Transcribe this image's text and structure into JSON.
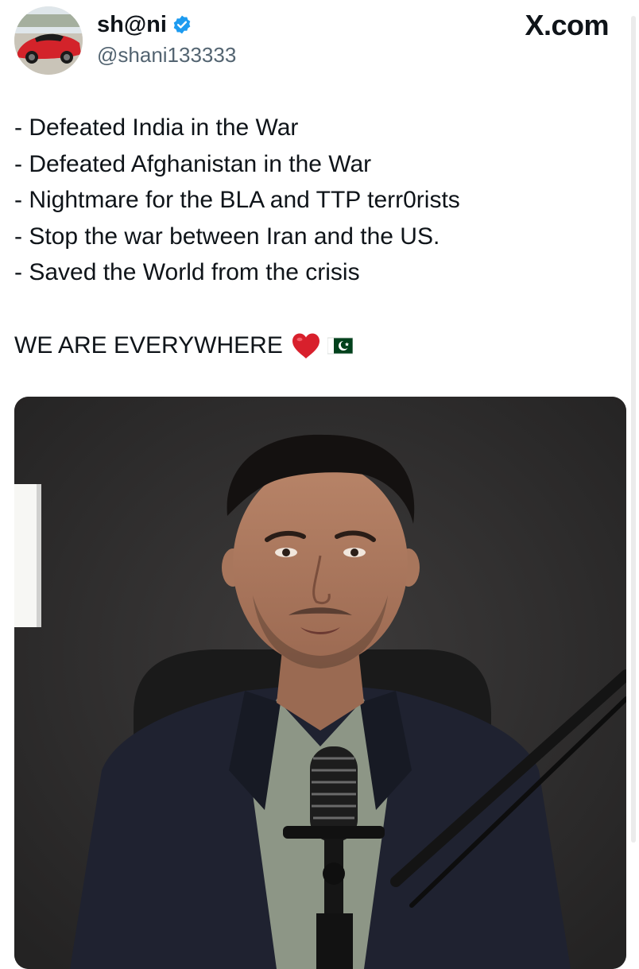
{
  "site": {
    "logo_text": "X.com"
  },
  "author": {
    "display_name": "sh@ni",
    "handle": "@shani133333",
    "verified": true,
    "avatar_icon": "red-sports-car-avatar"
  },
  "tweet": {
    "lines": [
      "- Defeated India in the War",
      "- Defeated Afghanistan in the War",
      "- Nightmare for the BLA and TTP terr0rists",
      "- Stop the war between Iran and the US.",
      "- Saved the World from the crisis"
    ],
    "tagline": "WE ARE EVERYWHERE",
    "emojis": [
      "red-heart",
      "pakistan-flag"
    ]
  },
  "media": {
    "type": "video-frame",
    "subject": "man-speaking-into-podcast-microphone"
  },
  "colors": {
    "verified_blue": "#1d9bf0",
    "text": "#0f1419",
    "secondary_text": "#536471",
    "heart_red": "#d8202c",
    "flag_green": "#01411c"
  }
}
